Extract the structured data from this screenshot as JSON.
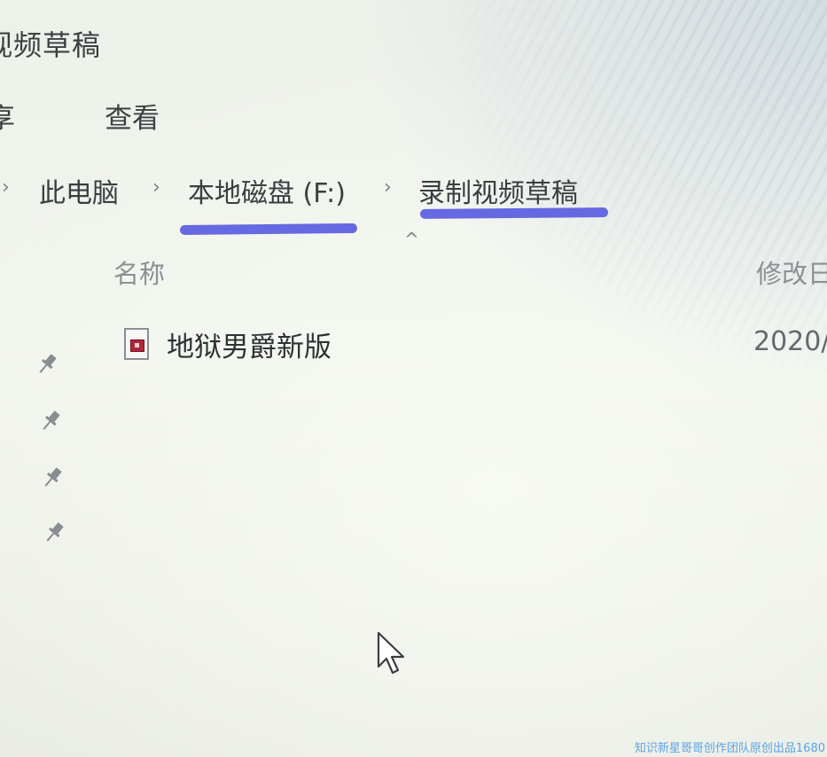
{
  "window": {
    "title": "视频草稿"
  },
  "ribbon": {
    "share_label": "享",
    "view_label": "查看"
  },
  "breadcrumb": {
    "items": [
      "此电脑",
      "本地磁盘 (F:)",
      "录制视频草稿"
    ],
    "separator": "›"
  },
  "columns": {
    "name": "名称",
    "modified": "修改日"
  },
  "files": [
    {
      "name": "地狱男爵新版",
      "modified": "2020/",
      "icon": "video-file-icon"
    }
  ],
  "quick_access": {
    "pinned_icon": "pin-icon",
    "pinned_count": 4
  },
  "annotations": {
    "underline_color": "#5a5ce0"
  },
  "watermark": "知识新星哥哥创作团队原创出品1680"
}
